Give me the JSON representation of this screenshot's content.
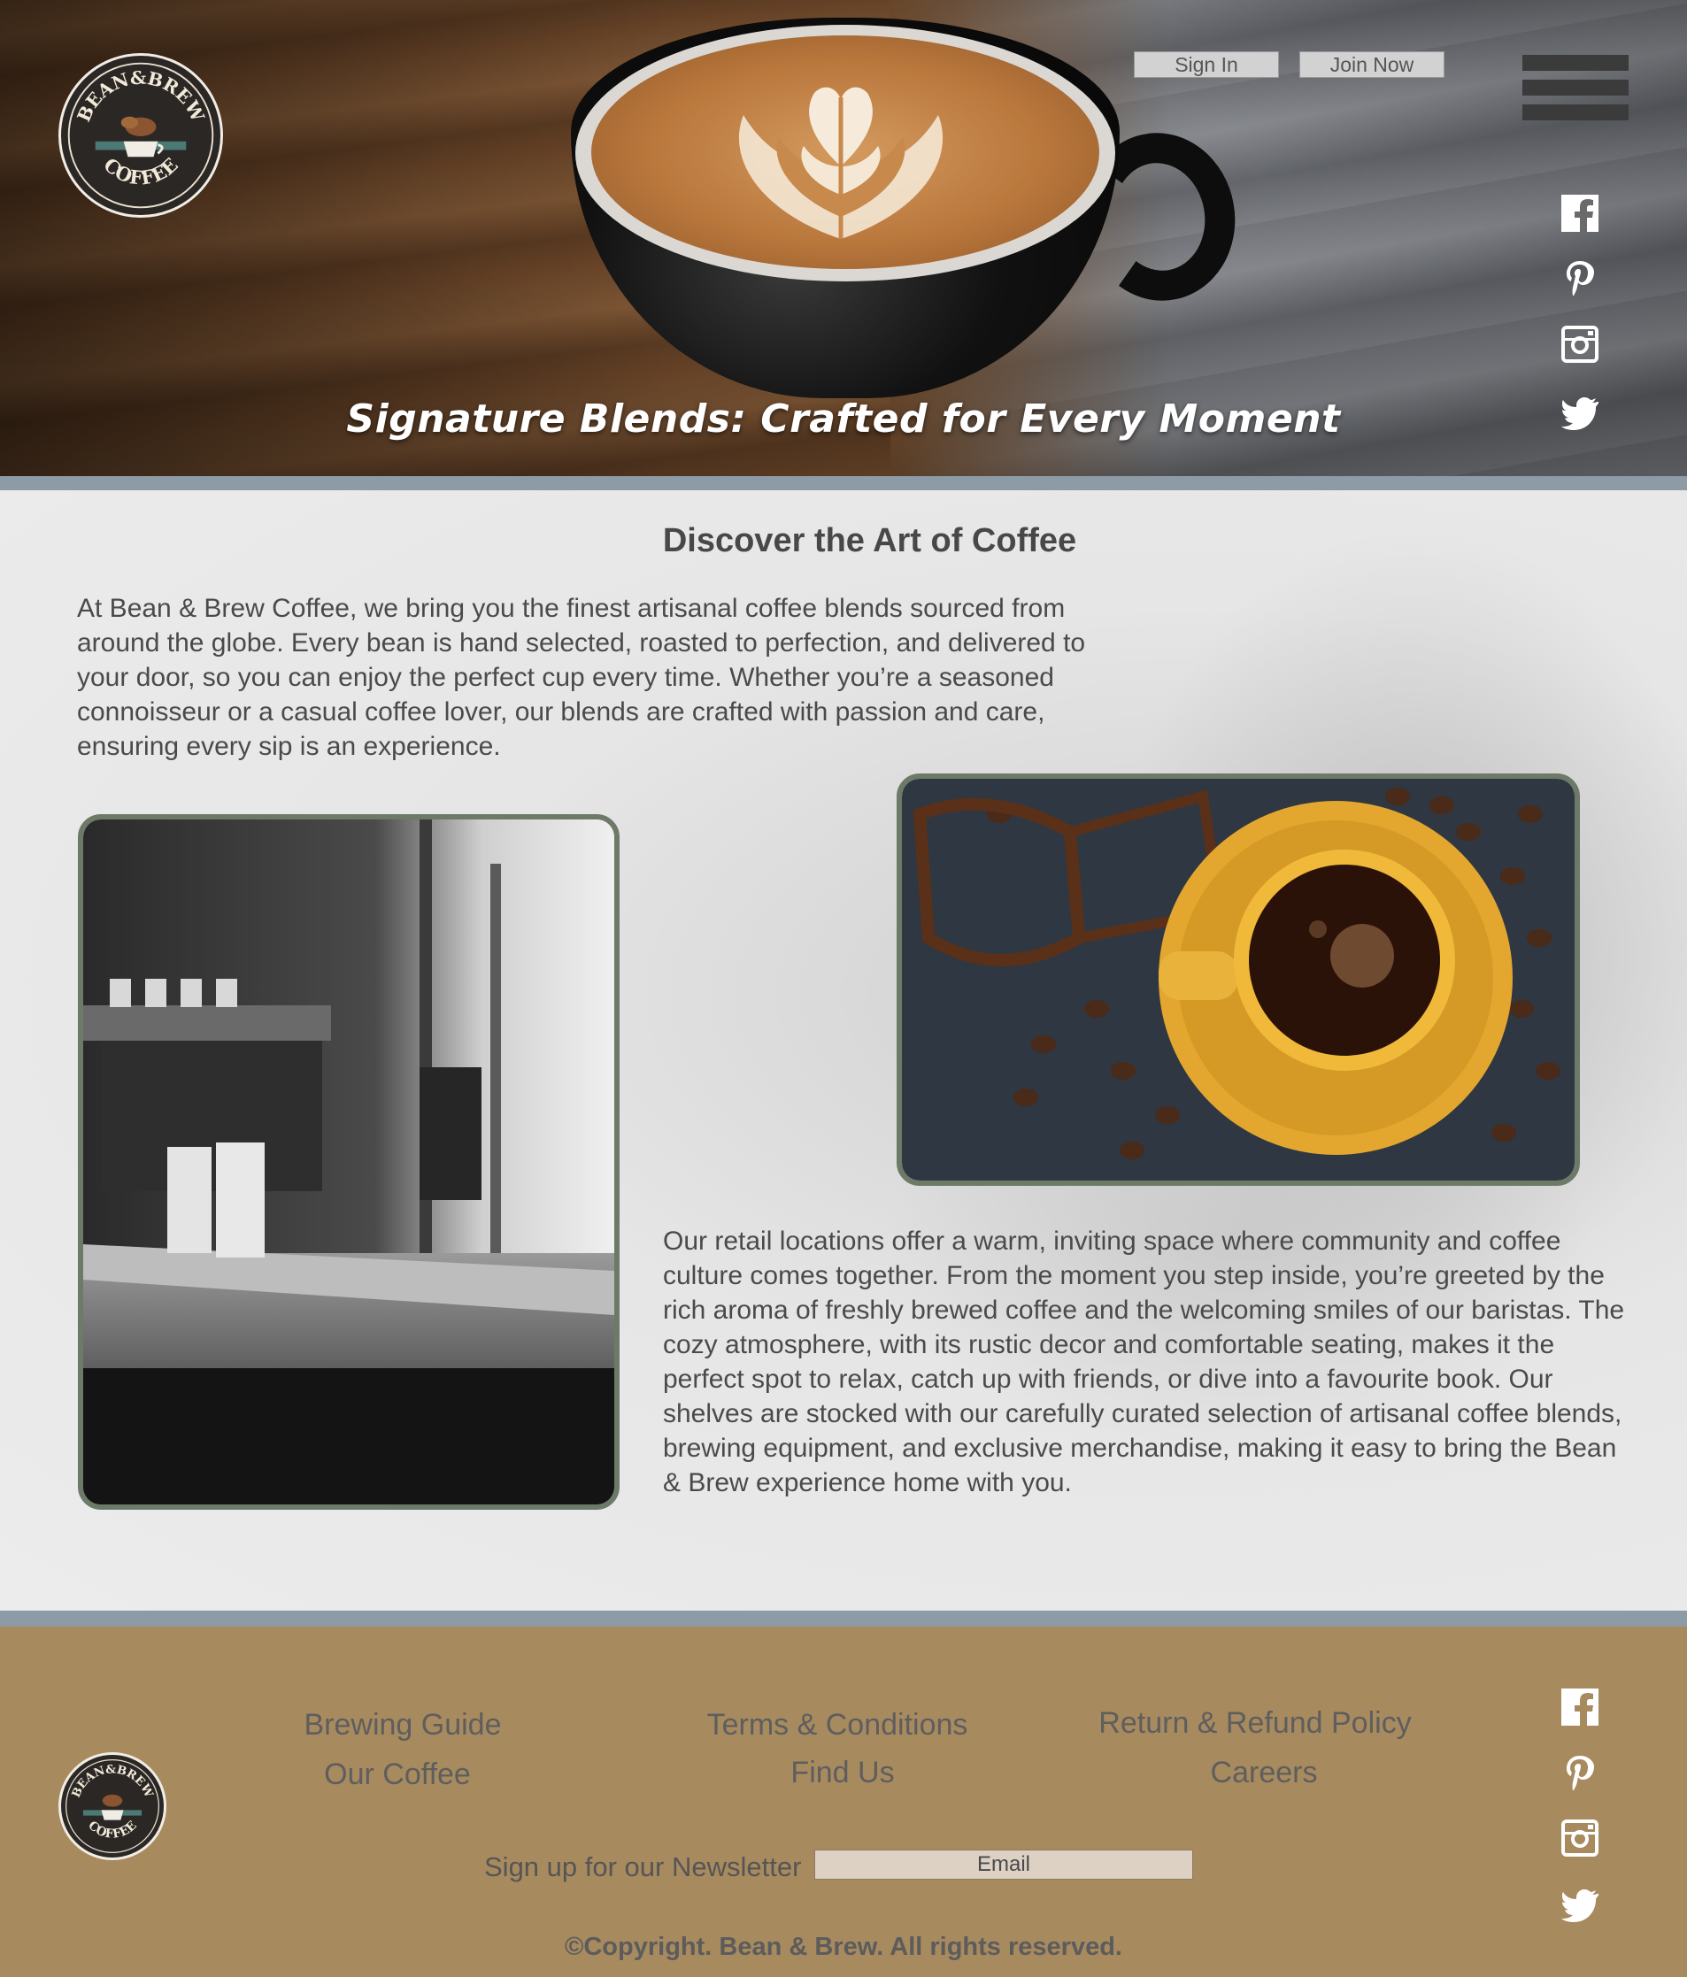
{
  "header": {
    "logo": {
      "name": "logo",
      "top_text": "BEAN&BREW",
      "bottom_text": "COFFEE"
    },
    "sign_in_label": "Sign In",
    "join_now_label": "Join Now",
    "menu_icon": "hamburger-menu-icon",
    "social": [
      {
        "icon": "facebook-icon"
      },
      {
        "icon": "pinterest-icon"
      },
      {
        "icon": "instagram-icon"
      },
      {
        "icon": "twitter-icon"
      }
    ]
  },
  "hero": {
    "title": "Signature Blends: Crafted for Every Moment"
  },
  "main": {
    "heading": "Discover the Art of Coffee",
    "intro": "At Bean & Brew Coffee, we bring you the finest artisanal coffee blends sourced from around the globe. Every bean is hand selected, roasted to perfection, and delivered to your door, so you can enjoy the perfect cup every time. Whether you’re a seasoned connoisseur or a casual coffee lover, our blends are crafted with passion and care, ensuring every sip is an experience.",
    "retail": "Our retail locations offer a warm, inviting space where community and coffee culture comes together. From the moment you step inside, you’re greeted by the rich aroma of freshly brewed coffee and the welcoming smiles of our baristas. The cozy atmosphere, with its rustic decor and comfortable seating, makes it the perfect spot to relax, catch up with friends, or dive into a favourite book. Our shelves are stocked with our carefully curated selection of artisanal coffee blends, brewing equipment, and exclusive merchandise, making it easy to bring the Bean & Brew experience home with you."
  },
  "footer": {
    "links": {
      "brewing_guide": "Brewing Guide",
      "our_coffee": "Our Coffee",
      "terms": "Terms & Conditions",
      "find_us": "Find Us",
      "refund": "Return & Refund Policy",
      "careers": "Careers"
    },
    "newsletter_label": "Sign up for our Newsletter",
    "email_placeholder": "Email",
    "copyright": "©Copyright. Bean & Brew. All rights reserved."
  },
  "colors": {
    "footer_bg": "#a88a5f",
    "divider": "#8d9ba6",
    "photo_border": "#6d7a68"
  }
}
